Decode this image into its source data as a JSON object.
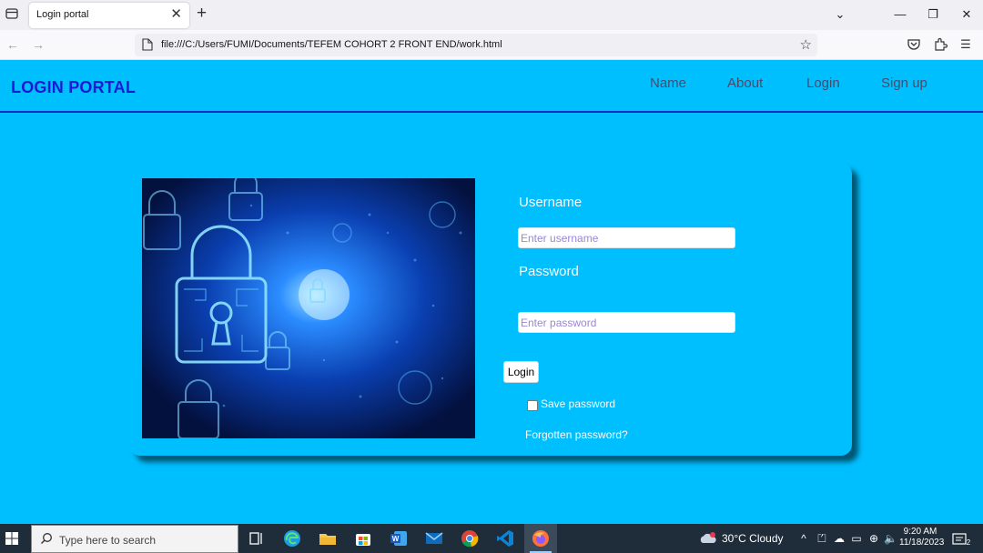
{
  "browser": {
    "tab_title": "Login portal",
    "tab_close": "✕",
    "new_tab": "+",
    "url": "file:///C:/Users/FUMI/Documents/TEFEM COHORT 2 FRONT END/work.html",
    "window_controls": {
      "chevron": "⌄",
      "minimize": "—",
      "restore": "❐",
      "close": "✕"
    }
  },
  "site": {
    "brand": "LOGIN PORTAL",
    "nav": [
      "Name",
      "About",
      "Login",
      "Sign up"
    ]
  },
  "form": {
    "username_label": "Username",
    "username_placeholder": "Enter username",
    "password_label": "Password",
    "password_placeholder": "Enter password",
    "login_button": "Login",
    "save_password": "Save password",
    "forgot_password": "Forgotten password?"
  },
  "taskbar": {
    "search_placeholder": "Type here to search",
    "weather": "30°C  Cloudy",
    "time": "9:20 AM",
    "date": "11/18/2023",
    "notification_count": "2",
    "apps": [
      "task-view",
      "edge",
      "file-explorer",
      "store",
      "word",
      "mail",
      "chrome",
      "vscode",
      "firefox"
    ]
  },
  "colors": {
    "page_bg": "#00BFFF",
    "brand": "#1B1BD6",
    "nav_text": "#4B4A6A",
    "header_border": "#1A2EC6"
  }
}
